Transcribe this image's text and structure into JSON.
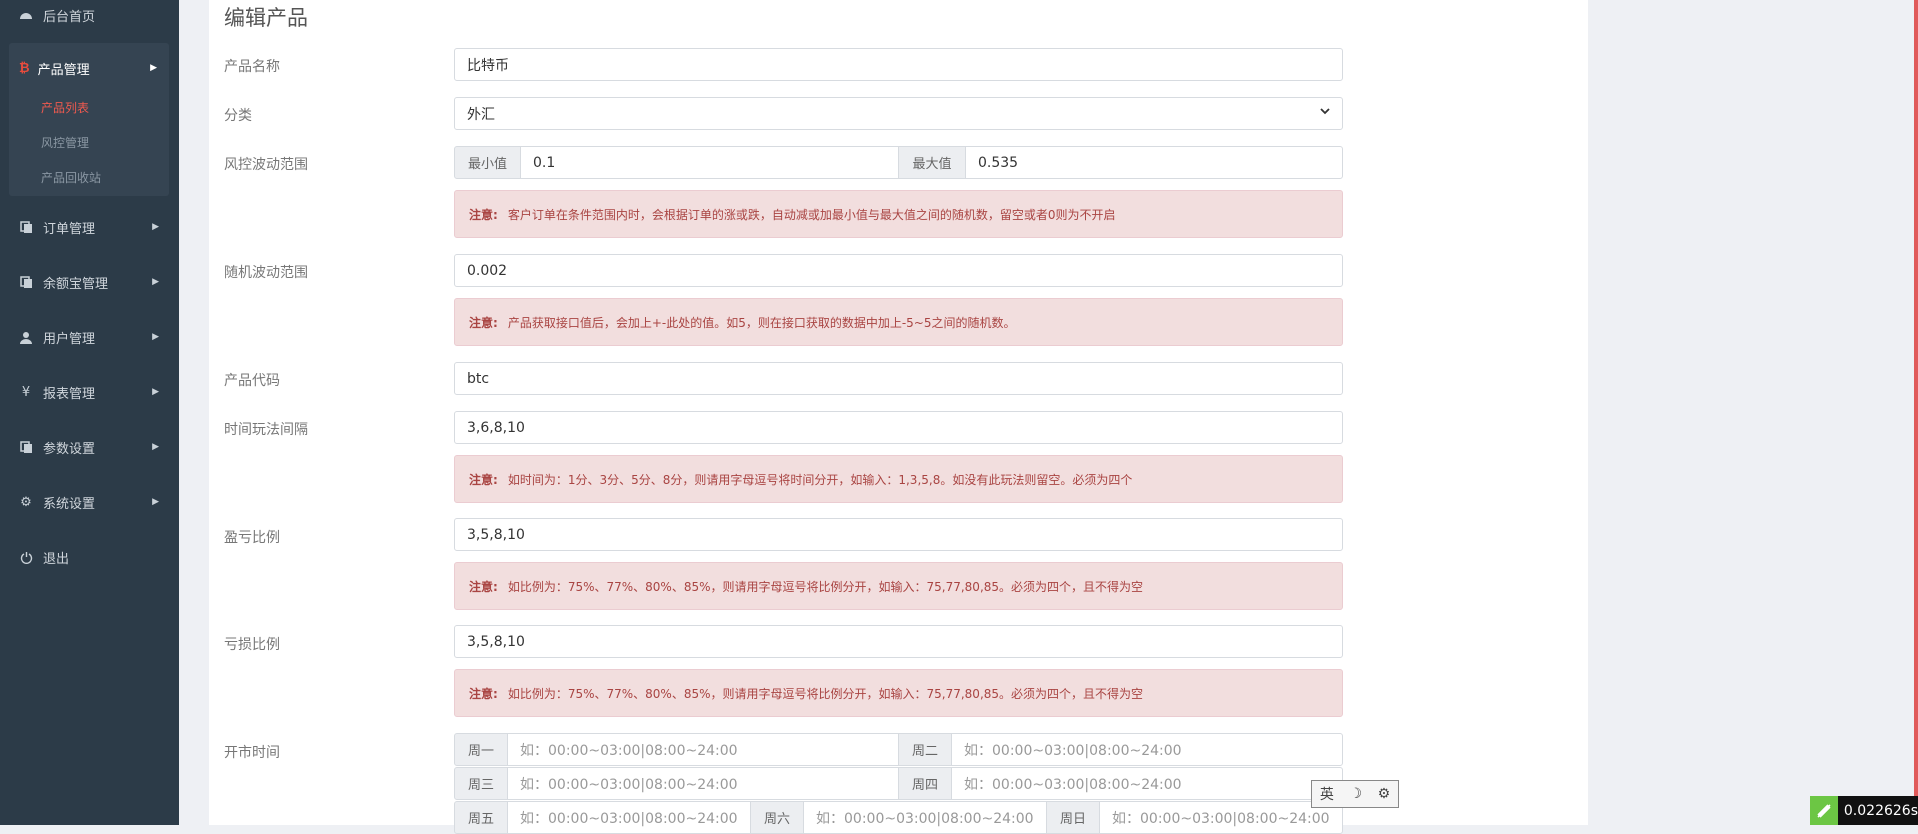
{
  "sidebar": {
    "home": "后台首页",
    "product_mgmt": "产品管理",
    "product_list": "产品列表",
    "risk_mgmt": "风控管理",
    "product_recycle": "产品回收站",
    "order_mgmt": "订单管理",
    "yuebao_mgmt": "余额宝管理",
    "user_mgmt": "用户管理",
    "report_mgmt": "报表管理",
    "param_settings": "参数设置",
    "system_settings": "系统设置",
    "logout": "退出"
  },
  "form": {
    "title": "编辑产品",
    "product_name": {
      "label": "产品名称",
      "value": "比特币"
    },
    "category": {
      "label": "分类",
      "value": "外汇"
    },
    "risk_range": {
      "label": "风控波动范围",
      "min_label": "最小值",
      "min_value": "0.1",
      "max_label": "最大值",
      "max_value": "0.535",
      "note_title": "注意:",
      "note": "客户订单在条件范围内时，会根据订单的涨或跌，自动减或加最小值与最大值之间的随机数，留空或者0则为不开启"
    },
    "random_range": {
      "label": "随机波动范围",
      "value": "0.002",
      "note_title": "注意:",
      "note": "产品获取接口值后，会加上+-此处的值。如5，则在接口获取的数据中加上-5~5之间的随机数。"
    },
    "product_code": {
      "label": "产品代码",
      "value": "btc"
    },
    "time_interval": {
      "label": "时间玩法间隔",
      "value": "3,6,8,10",
      "note_title": "注意:",
      "note": "如时间为：1分、3分、5分、8分，则请用字母逗号将时间分开，如输入：1,3,5,8。如没有此玩法则留空。必须为四个"
    },
    "profit_ratio": {
      "label": "盈亏比例",
      "value": "3,5,8,10",
      "note_title": "注意:",
      "note": "如比例为：75%、77%、80%、85%，则请用字母逗号将比例分开，如输入：75,77,80,85。必须为四个，且不得为空"
    },
    "loss_ratio": {
      "label": "亏损比例",
      "value": "3,5,8,10",
      "note_title": "注意:",
      "note": "如比例为：75%、77%、80%、85%，则请用字母逗号将比例分开，如输入：75,77,80,85。必须为四个，且不得为空"
    },
    "open_time": {
      "label": "开市时间",
      "placeholder": "如：00:00~03:00|08:00~24:00",
      "days": [
        "周一",
        "周二",
        "周三",
        "周四",
        "周五",
        "周六",
        "周日"
      ]
    }
  },
  "ime": {
    "mode": "英",
    "moon": "☽",
    "settings": "⚙"
  },
  "timer": {
    "value": "0.022626s"
  },
  "colors": {
    "sidebar": "#2c3b48",
    "accent": "#f05a4f",
    "alert_bg": "#f2dede",
    "alert_text": "#a94442"
  }
}
